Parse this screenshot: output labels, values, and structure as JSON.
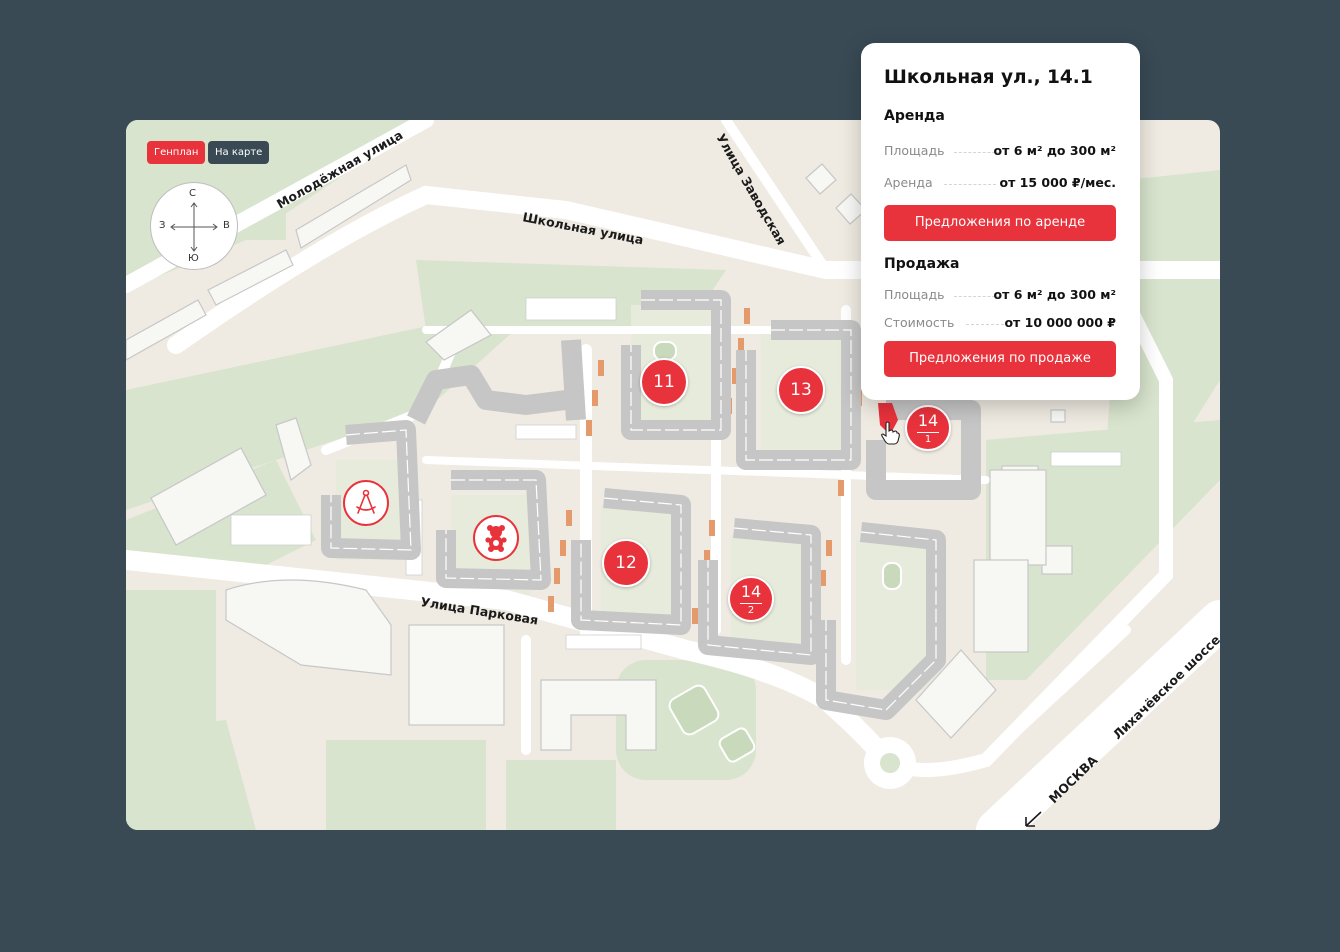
{
  "map": {
    "toggles": {
      "genplan": "Генплан",
      "on_map": "На карте"
    },
    "compass": {
      "north": "С",
      "south": "Ю",
      "west": "З",
      "east": "В"
    },
    "streets": {
      "molodezhnaya": "Молодёжная улица",
      "zavodskaya": "Улица Заводская",
      "shkolnaya": "Школьная улица",
      "parkovaya": "Улица Парковая",
      "likhachevskoe": "Лихачёвское шоссе",
      "moskva": "МОСКВА"
    },
    "markers": {
      "b11": "11",
      "b12": "12",
      "b13": "13",
      "b14_1": {
        "main": "14",
        "sub": "1"
      },
      "b14_2": {
        "main": "14",
        "sub": "2"
      }
    },
    "icons": {
      "school": "compass-drawing-icon",
      "kindergarten": "teddy-bear-icon",
      "pointer": "hand-pointer-icon"
    },
    "colors": {
      "accent": "#e8323c",
      "background": "#394a55",
      "map_base": "#efebe2",
      "green": "#d7e3cc",
      "building": "#c9c9c9"
    }
  },
  "popup": {
    "title": "Школьная ул., 14.1",
    "rent": {
      "heading": "Аренда",
      "area_label": "Площадь",
      "area_value": "от 6 м² до 300 м²",
      "price_label": "Аренда",
      "price_value": "от 15 000 ₽/мес.",
      "button": "Предложения по аренде"
    },
    "sale": {
      "heading": "Продажа",
      "area_label": "Площадь",
      "area_value": "от 6 м² до 300 м²",
      "price_label": "Стоимость",
      "price_value": "от 10 000 000 ₽",
      "button": "Предложения по продаже"
    }
  }
}
